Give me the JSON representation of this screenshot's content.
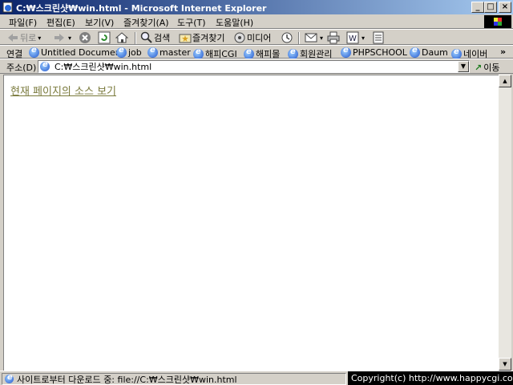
{
  "window": {
    "title": "C:₩스크린샷₩win.html - Microsoft Internet Explorer"
  },
  "menu": [
    "파일(F)",
    "편집(E)",
    "보기(V)",
    "즐겨찾기(A)",
    "도구(T)",
    "도움말(H)"
  ],
  "toolbar": {
    "back_label": "뒤로",
    "search_label": "검색",
    "favorites_label": "즐겨찾기",
    "media_label": "미디어"
  },
  "links": {
    "label": "연결",
    "items": [
      "Untitled Document",
      "job",
      "master",
      "해피CGI",
      "해피몰",
      "회원관리",
      "PHPSCHOOL",
      "Daum",
      "네이버"
    ]
  },
  "address": {
    "label": "주소(D)",
    "value": "C:₩스크린샷₩win.html",
    "go_label": "이동"
  },
  "content": {
    "link_text": "현재 페이지의 소스 보기"
  },
  "status": {
    "text": "사이트로부터 다운로드 중: file://C:₩스크린샷₩win.html"
  },
  "copyright": "Copyright(c) http://www.happycgi.com",
  "colors": {
    "titlebar_start": "#0a246a",
    "titlebar_end": "#a6caf0",
    "chrome": "#d4d0c8",
    "link_visited": "#7a7a3c"
  }
}
